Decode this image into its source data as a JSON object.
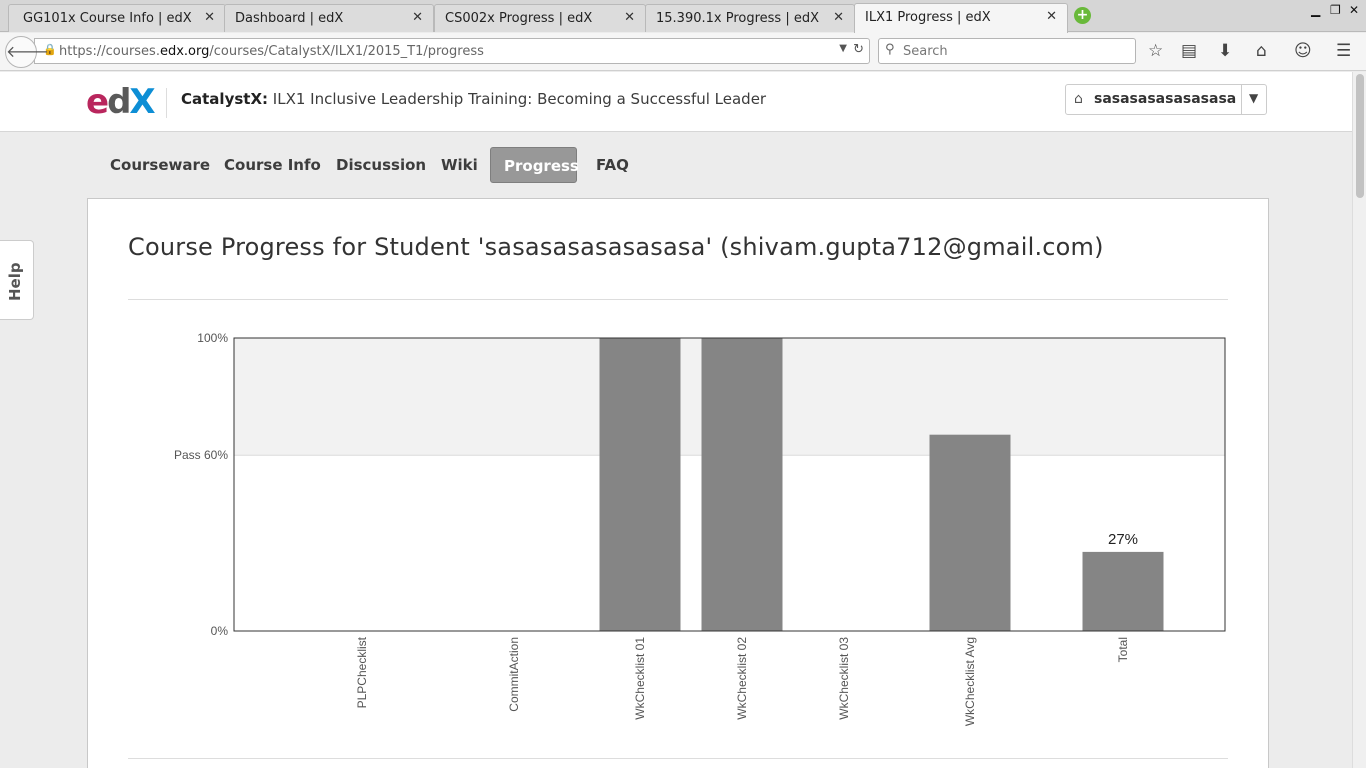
{
  "browser": {
    "tabs": [
      {
        "title": "GG101x Course Info | edX",
        "active": false
      },
      {
        "title": "Dashboard | edX",
        "active": false
      },
      {
        "title": "CS002x Progress | edX",
        "active": false
      },
      {
        "title": "15.390.1x Progress | edX",
        "active": false
      },
      {
        "title": "ILX1 Progress | edX",
        "active": true
      }
    ],
    "url_prefix": "https://courses.",
    "url_domain": "edx.org",
    "url_path": "/courses/CatalystX/ILX1/2015_T1/progress",
    "search_placeholder": "Search"
  },
  "header": {
    "logo": {
      "part1": "e",
      "part2": "d",
      "part3": "X"
    },
    "course_org": "CatalystX:",
    "course_name": " ILX1 Inclusive Leadership Training: Becoming a Successful Leader",
    "username": "sasasasasasasasa"
  },
  "course_nav": {
    "tabs": [
      {
        "label": "Courseware",
        "active": false
      },
      {
        "label": "Course Info",
        "active": false
      },
      {
        "label": "Discussion",
        "active": false
      },
      {
        "label": "Wiki",
        "active": false
      },
      {
        "label": "Progress",
        "active": true
      },
      {
        "label": "FAQ",
        "active": false
      }
    ]
  },
  "help_label": "Help",
  "main": {
    "title": "Course Progress for Student 'sasasasasasasasa' (shivam.gupta712@gmail.com)"
  },
  "chart_data": {
    "type": "bar",
    "categories": [
      "PLPChecklist",
      "CommitAction",
      "WkChecklist 01",
      "WkChecklist 02",
      "WkChecklist 03",
      "WkChecklist Avg",
      "Total"
    ],
    "values": [
      0,
      0,
      100,
      100,
      0,
      67,
      27
    ],
    "ylim": [
      0,
      100
    ],
    "yticks": [
      {
        "value": 0,
        "label": "0%"
      },
      {
        "value": 60,
        "label": "Pass 60%"
      },
      {
        "value": 100,
        "label": "100%"
      }
    ],
    "pass_threshold": 60,
    "data_labels": [
      {
        "category": "Total",
        "label": "27%"
      }
    ],
    "bar_color": "#858585",
    "pass_band_color": "#f2f2f2"
  }
}
